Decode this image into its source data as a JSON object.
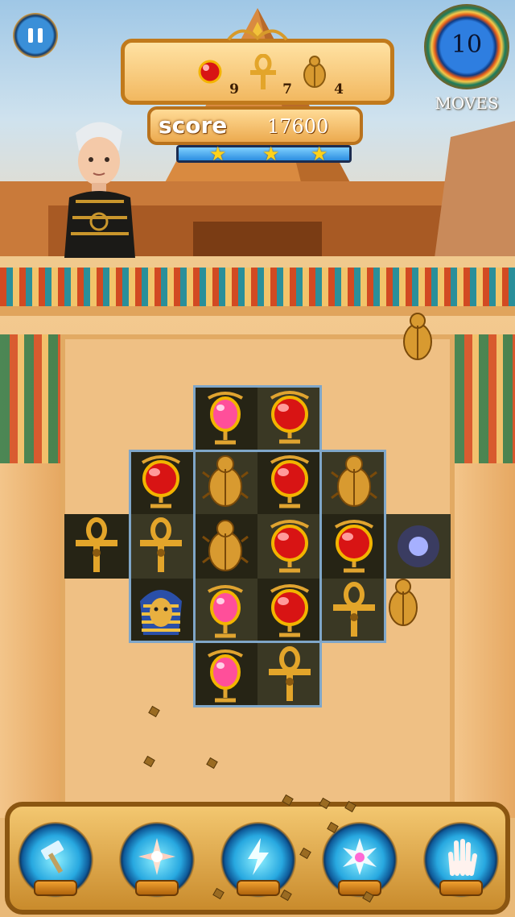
{
  "hud": {
    "goals": [
      {
        "icon": "red-gem-icon",
        "count": "9"
      },
      {
        "icon": "ankh-icon",
        "count": "7"
      },
      {
        "icon": "scarab-icon",
        "count": "4"
      }
    ],
    "score_label": "score",
    "score_value": "17600",
    "progress_stars": 3,
    "moves_value": "10",
    "moves_label": "MOVES"
  },
  "board": {
    "rows": [
      [
        null,
        null,
        "pink-gem",
        "red-gem",
        null,
        null
      ],
      [
        null,
        "red-gem",
        "scarab",
        "red-gem",
        "scarab",
        null
      ],
      [
        "ankh",
        "ankh",
        "scarab",
        "red-gem",
        "red-gem",
        "glow"
      ],
      [
        null,
        "pharaoh-mask",
        "pink-gem",
        "red-gem",
        "ankh",
        null
      ],
      [
        null,
        null,
        "pink-gem",
        "ankh",
        null,
        null
      ]
    ]
  },
  "boosters": [
    {
      "icon": "hammer-icon"
    },
    {
      "icon": "compass-icon"
    },
    {
      "icon": "bolt-icon"
    },
    {
      "icon": "burst-icon"
    },
    {
      "icon": "hand-icon"
    }
  ],
  "colors": {
    "gold": "#f0b447",
    "red_gem": "#d81414",
    "pink_gem": "#ff4f9a",
    "tile_dark": "#262415"
  }
}
